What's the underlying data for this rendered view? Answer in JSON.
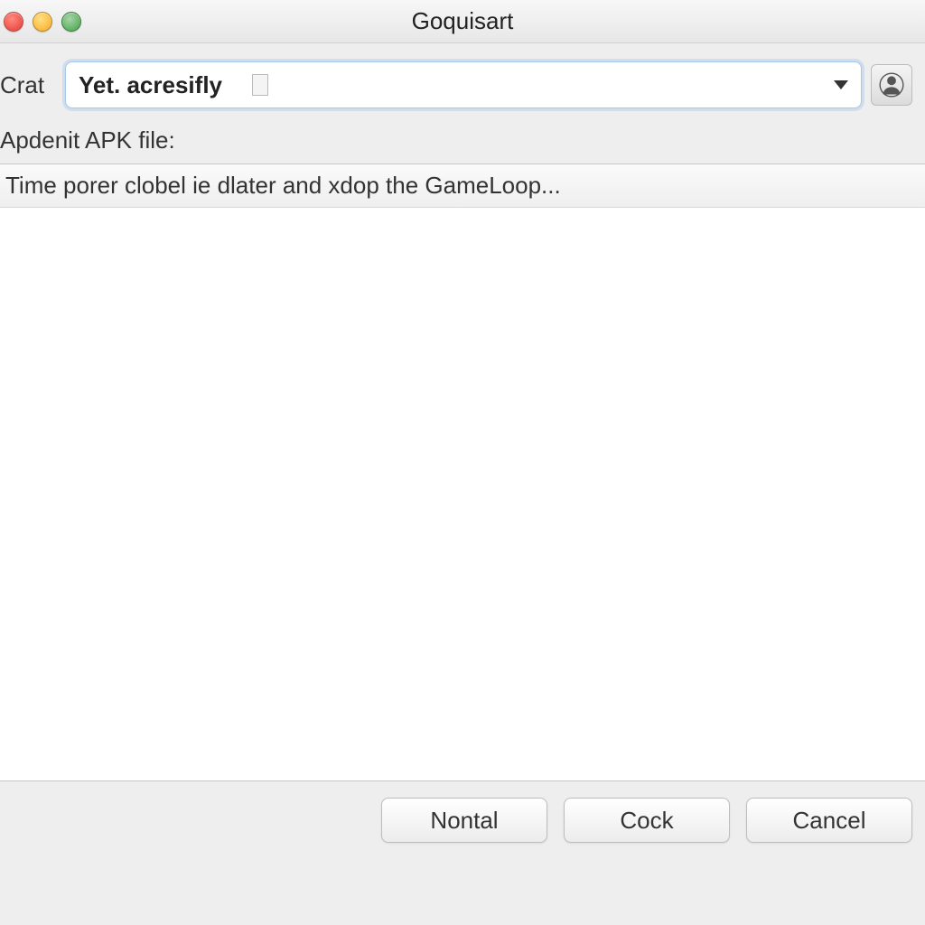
{
  "window": {
    "title": "Goquisart"
  },
  "form": {
    "crat_label": "Crat",
    "combo_value": "Yet. acresifly",
    "apk_label": "Apdenit APK file:",
    "list_header": "Time porer clobel ie dlater and xdop the GameLoop..."
  },
  "buttons": {
    "nontal": "Nontal",
    "cock": "Cock",
    "cancel": "Cancel"
  },
  "icons": {
    "profile": "profile-icon",
    "dropdown": "chevron-down-icon"
  }
}
